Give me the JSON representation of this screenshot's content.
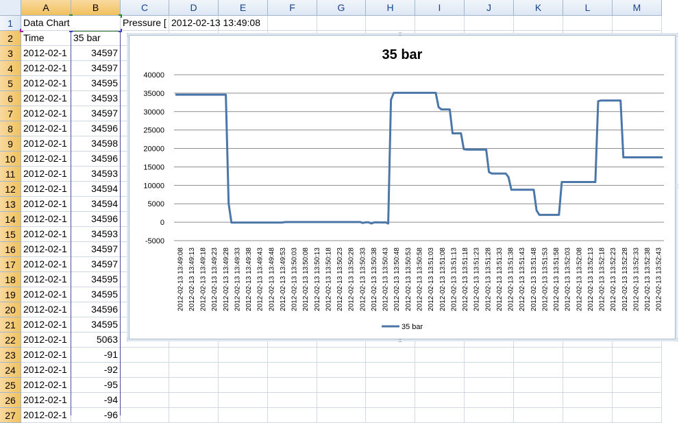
{
  "columns": [
    "A",
    "B",
    "C",
    "D",
    "E",
    "F",
    "G",
    "H",
    "I",
    "J",
    "K",
    "L",
    "M"
  ],
  "rows": [
    1,
    2,
    3,
    4,
    5,
    6,
    7,
    8,
    9,
    10,
    11,
    12,
    13,
    14,
    15,
    16,
    17,
    18,
    19,
    20,
    21,
    22,
    23,
    24,
    25,
    26,
    27
  ],
  "cells": {
    "a1": "Data Chart",
    "c1": "Pressure [",
    "d1": "2012-02-13  13:49:08",
    "a2": "Time",
    "b2": "35 bar"
  },
  "data_rows": [
    {
      "time": "2012-02-1",
      "value": "34597"
    },
    {
      "time": "2012-02-1",
      "value": "34597"
    },
    {
      "time": "2012-02-1",
      "value": "34595"
    },
    {
      "time": "2012-02-1",
      "value": "34593"
    },
    {
      "time": "2012-02-1",
      "value": "34597"
    },
    {
      "time": "2012-02-1",
      "value": "34596"
    },
    {
      "time": "2012-02-1",
      "value": "34598"
    },
    {
      "time": "2012-02-1",
      "value": "34596"
    },
    {
      "time": "2012-02-1",
      "value": "34593"
    },
    {
      "time": "2012-02-1",
      "value": "34594"
    },
    {
      "time": "2012-02-1",
      "value": "34594"
    },
    {
      "time": "2012-02-1",
      "value": "34596"
    },
    {
      "time": "2012-02-1",
      "value": "34593"
    },
    {
      "time": "2012-02-1",
      "value": "34597"
    },
    {
      "time": "2012-02-1",
      "value": "34597"
    },
    {
      "time": "2012-02-1",
      "value": "34595"
    },
    {
      "time": "2012-02-1",
      "value": "34595"
    },
    {
      "time": "2012-02-1",
      "value": "34596"
    },
    {
      "time": "2012-02-1",
      "value": "34595"
    },
    {
      "time": "2012-02-1",
      "value": "5063"
    },
    {
      "time": "2012-02-1",
      "value": "-91"
    },
    {
      "time": "2012-02-1",
      "value": "-92"
    },
    {
      "time": "2012-02-1",
      "value": "-95"
    },
    {
      "time": "2012-02-1",
      "value": "-94"
    },
    {
      "time": "2012-02-1",
      "value": "-96"
    }
  ],
  "colors": {
    "series": "#4a76a8",
    "grid": "#8c8c8c",
    "header_sel": "#f1c15f"
  },
  "chart_data": {
    "type": "line",
    "title": "35 bar",
    "xlabel": "",
    "ylabel": "",
    "ylim": [
      -5000,
      40000
    ],
    "yticks": [
      -5000,
      0,
      5000,
      10000,
      15000,
      20000,
      25000,
      30000,
      35000,
      40000
    ],
    "grid": true,
    "legend_position": "bottom",
    "categories": [
      "2012-02-13 13:49:08",
      "2012-02-13 13:49:13",
      "2012-02-13 13:49:18",
      "2012-02-13 13:49:23",
      "2012-02-13 13:49:28",
      "2012-02-13 13:49:33",
      "2012-02-13 13:49:38",
      "2012-02-13 13:49:43",
      "2012-02-13 13:49:48",
      "2012-02-13 13:49:53",
      "2012-02-13 13:49:58",
      "2012-02-13 13:50:03",
      "2012-02-13 13:50:08",
      "2012-02-13 13:50:13",
      "2012-02-13 13:50:18",
      "2012-02-13 13:50:23",
      "2012-02-13 13:50:28",
      "2012-02-13 13:50:33",
      "2012-02-13 13:50:38",
      "2012-02-13 13:50:43",
      "2012-02-13 13:50:48",
      "2012-02-13 13:50:53",
      "2012-02-13 13:50:58",
      "2012-02-13 13:51:03",
      "2012-02-13 13:51:08",
      "2012-02-13 13:51:13",
      "2012-02-13 13:51:18",
      "2012-02-13 13:51:23",
      "2012-02-13 13:51:28",
      "2012-02-13 13:51:33",
      "2012-02-13 13:51:38",
      "2012-02-13 13:51:43",
      "2012-02-13 13:51:48",
      "2012-02-13 13:51:53",
      "2012-02-13 13:51:58",
      "2012-02-13 13:52:03",
      "2012-02-13 13:52:08",
      "2012-02-13 13:52:13",
      "2012-02-13 13:52:18",
      "2012-02-13 13:52:23",
      "2012-02-13 13:52:28",
      "2012-02-13 13:52:33",
      "2012-02-13 13:52:38",
      "2012-02-13 13:52:43"
    ],
    "tick_labels": [
      "2012-02-13 13:49:08",
      "2012-02-13 13:49:13",
      "2012-02-13 13:49:18",
      "2012-02-13 13:49:23",
      "2012-02-13 13:49:28",
      "2012-02-13 13:49:33",
      "2012-02-13 13:49:38",
      "2012-02-13 13:49:43",
      "2012-02-13 13:49:48",
      "2012-02-13 13:49:53",
      "2012-02-13 13:50:03",
      "2012-02-13 13:50:08",
      "2012-02-13 13:50:13",
      "2012-02-13 13:50:18",
      "2012-02-13 13:50:23",
      "2012-02-13 13:50:28",
      "2012-02-13 13:50:33",
      "2012-02-13 13:50:38",
      "2012-02-13 13:50:43",
      "2012-02-13 13:50:48",
      "2012-02-13 13:50:53",
      "2012-02-13 13:50:58",
      "2012-02-13 13:51:03",
      "2012-02-13 13:51:08",
      "2012-02-13 13:51:13",
      "2012-02-13 13:51:18",
      "2012-02-13 13:51:23",
      "2012-02-13 13:51:28",
      "2012-02-13 13:51:33",
      "2012-02-13 13:51:38",
      "2012-02-13 13:51:43",
      "2012-02-13 13:51:48",
      "2012-02-13 13:51:53",
      "2012-02-13 13:51:58",
      "2012-02-13 13:52:03",
      "2012-02-13 13:52:08",
      "2012-02-13 13:52:13",
      "2012-02-13 13:52:18",
      "2012-02-13 13:52:23",
      "2012-02-13 13:52:28",
      "2012-02-13 13:52:33",
      "2012-02-13 13:52:38",
      "2012-02-13 13:52:43"
    ],
    "series": [
      {
        "name": "35 bar",
        "values": [
          34597,
          34597,
          34595,
          34593,
          34597,
          34596,
          34597,
          34596,
          34595,
          34596,
          34595,
          34595,
          34594,
          34596,
          34595,
          34596,
          34595,
          34596,
          34595,
          5063,
          -91,
          -92,
          -95,
          -94,
          -96,
          -94,
          -93,
          -95,
          -94,
          -92,
          -94,
          -93,
          -94,
          -95,
          -94,
          -93,
          -96,
          -95,
          -94,
          20,
          30,
          40,
          35,
          38,
          40,
          36,
          42,
          38,
          35,
          40,
          38,
          36,
          35,
          40,
          38,
          42,
          36,
          38,
          40,
          36,
          38,
          40,
          35,
          38,
          42,
          36,
          38,
          -200,
          -20,
          -30,
          -350,
          -50,
          -40,
          -60,
          -80,
          -30,
          -350,
          33200,
          35100,
          35100,
          35100,
          35100,
          35100,
          35100,
          35100,
          35100,
          35100,
          35100,
          35100,
          35100,
          35100,
          35100,
          35100,
          35100,
          31200,
          30600,
          30600,
          30600,
          30600,
          24100,
          24100,
          24100,
          24100,
          19800,
          19700,
          19700,
          19700,
          19700,
          19700,
          19700,
          19700,
          19700,
          13600,
          13200,
          13200,
          13200,
          13200,
          13200,
          13200,
          12200,
          8800,
          8800,
          8800,
          8800,
          8800,
          8800,
          8800,
          8800,
          8800,
          3200,
          2000,
          2000,
          2000,
          2000,
          2000,
          2000,
          2000,
          2000,
          10900,
          10900,
          10900,
          10900,
          10900,
          10900,
          10900,
          10900,
          10900,
          10900,
          10900,
          10900,
          10900,
          32800,
          33000,
          33000,
          33000,
          33000,
          33000,
          33000,
          33000,
          33000,
          17600,
          17600,
          17600,
          17600,
          17600,
          17600,
          17600,
          17600,
          17600,
          17600,
          17600,
          17600,
          17600,
          17600,
          17600
        ]
      }
    ]
  }
}
